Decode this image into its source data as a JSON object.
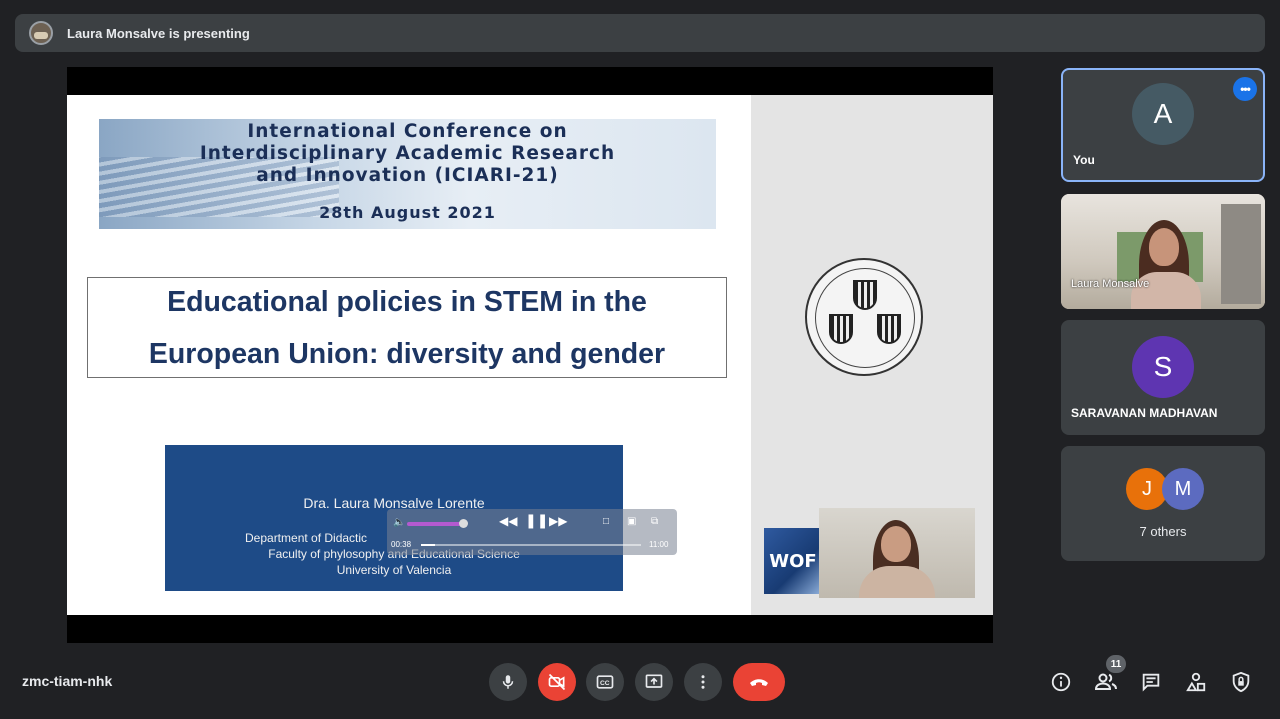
{
  "banner": {
    "text": "Laura Monsalve is presenting"
  },
  "slide": {
    "conference_title_1": "International Conference on",
    "conference_title_2": "Interdisciplinary Academic Research",
    "conference_title_3": "and Innovation (ICIARI-21)",
    "conference_date": "28th August 2021",
    "talk_title_1": "Educational policies in STEM in the",
    "talk_title_2": "European Union: diversity and gender",
    "author_name": "Dra. Laura Monsalve Lorente",
    "author_dept": "Department of Didactic",
    "author_faculty": "Faculty of phylosophy and Educational Science",
    "author_university": "University of Valencia",
    "player_current_time": "00:38",
    "player_total_time": "11:00",
    "logo_text": "WOF"
  },
  "participants": {
    "you": {
      "initial": "A",
      "label": "You",
      "color": "#455a64"
    },
    "laura": {
      "label": "Laura Monsalve"
    },
    "saravanan": {
      "initial": "S",
      "label": "SARAVANAN MADHAVAN",
      "color": "#5e35b1"
    },
    "others": {
      "avatars": [
        {
          "initial": "J",
          "color": "#e8710a"
        },
        {
          "initial": "M",
          "color": "#5c6bc0"
        }
      ],
      "label": "7 others"
    }
  },
  "bottom_bar": {
    "meeting_code": "zmc-tiam-nhk",
    "people_count": "11"
  },
  "icons": [
    "microphone-icon",
    "camera-off-icon",
    "captions-icon",
    "present-icon",
    "more-options-icon",
    "hang-up-icon",
    "info-icon",
    "people-icon",
    "chat-icon",
    "activities-icon",
    "host-controls-icon"
  ]
}
